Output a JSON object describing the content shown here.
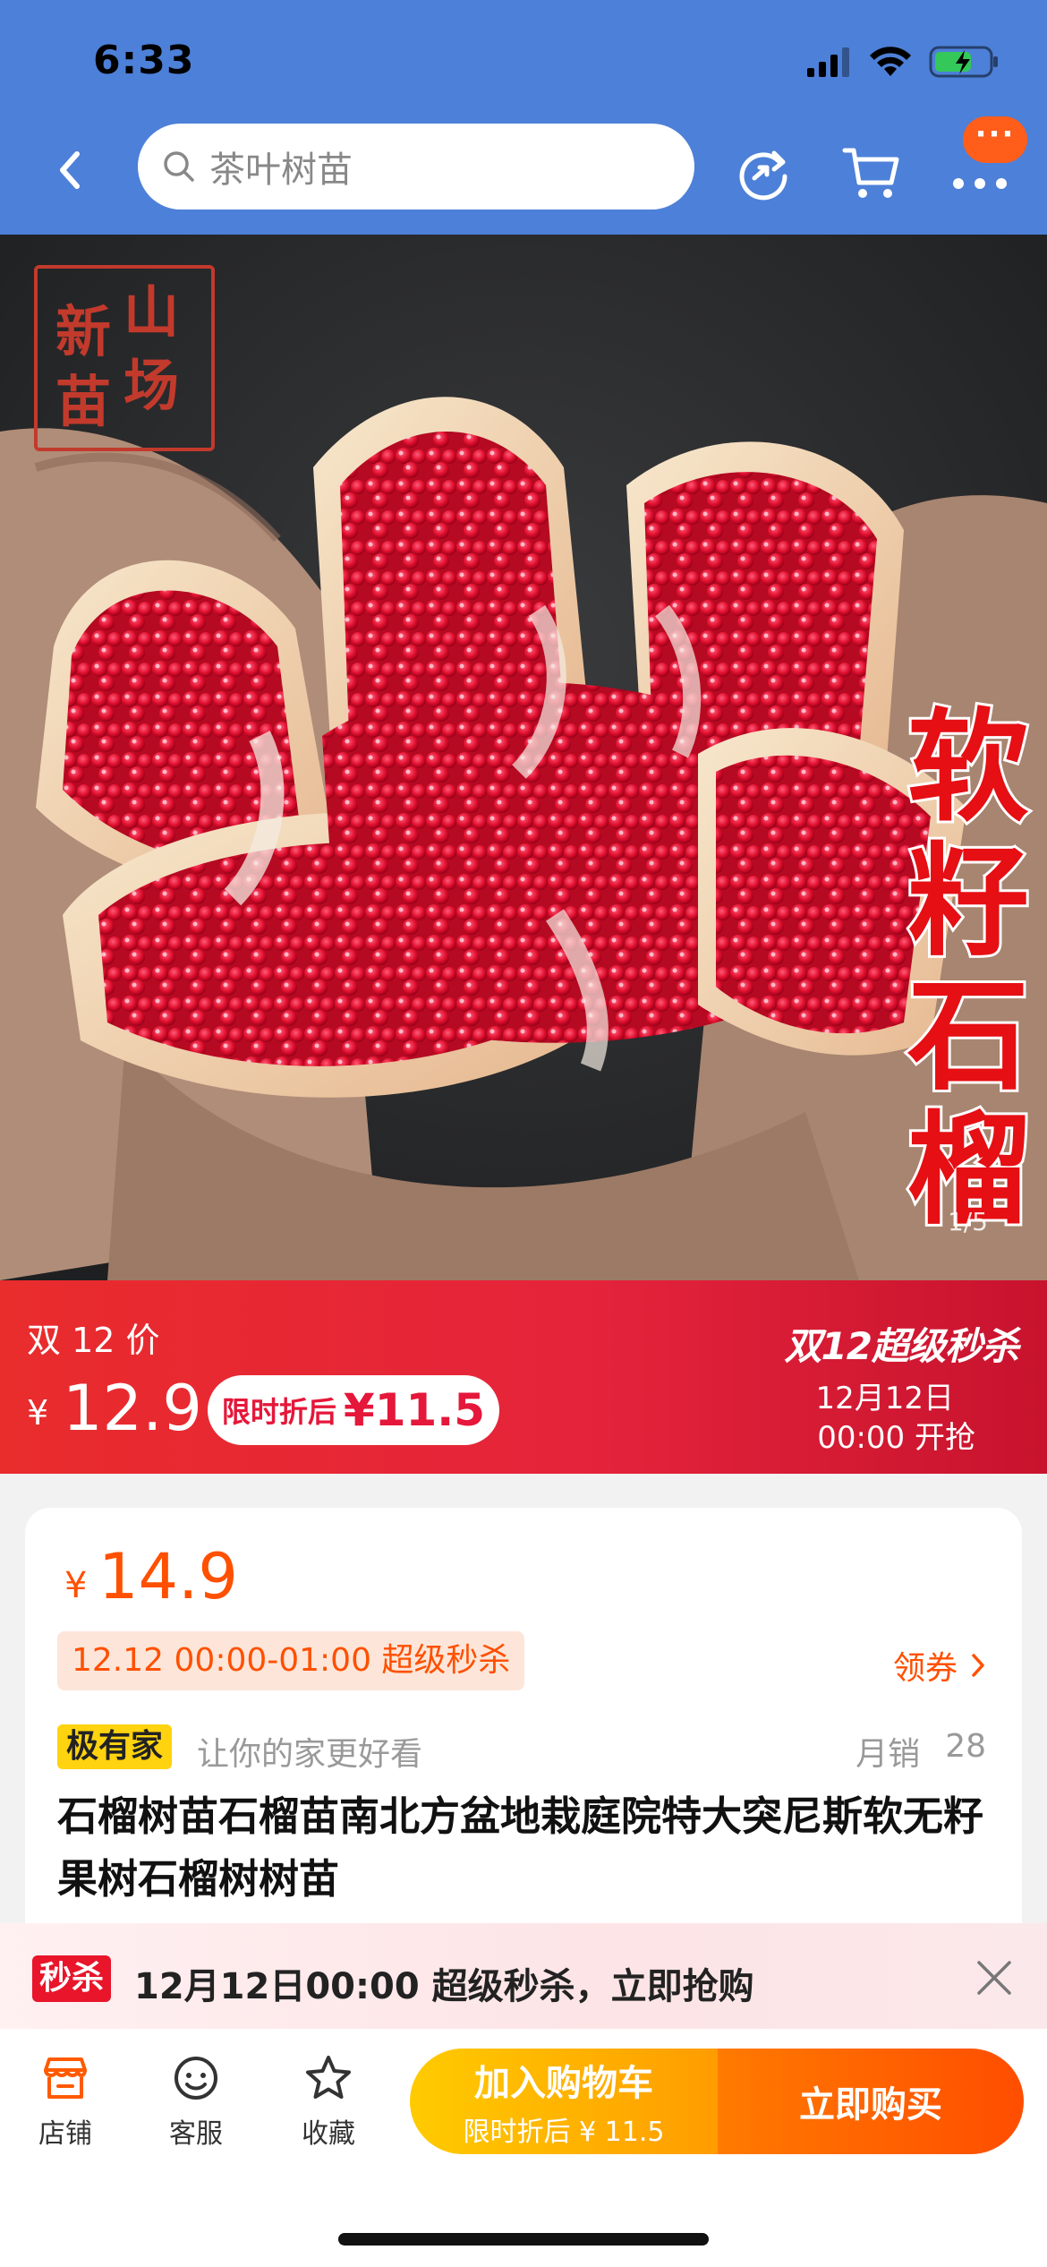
{
  "status_bar": {
    "time": "6:33"
  },
  "header": {
    "search_placeholder": "茶叶树苗",
    "more_badge": "···",
    "colors": {
      "bar": "#4d80d8",
      "accent": "#ff5d1a"
    }
  },
  "hero": {
    "seal_chars": [
      "新",
      "山",
      "苗",
      "场"
    ],
    "title_chars": [
      "软",
      "籽",
      "石",
      "榴"
    ],
    "pager": "1/5"
  },
  "promo": {
    "label": "双 12 价",
    "currency": "¥",
    "price": "12.9",
    "pill_label": "限时折后",
    "pill_price": "¥11.5",
    "event_title": "双12超级秒杀",
    "event_date": "12月12日",
    "event_time": "00:00 开抢"
  },
  "info": {
    "currency": "¥",
    "price": "14.9",
    "flash_tag": "12.12 00:00-01:00 超级秒杀",
    "coupon": "领券",
    "brand_badge": "极有家",
    "slogan": "让你的家更好看",
    "sales_label": "月销",
    "sales_count": "28",
    "title": "石榴树苗石榴苗南北方盆地栽庭院特大突尼斯软无籽果树石榴树树苗"
  },
  "notice": {
    "tag": "秒杀",
    "text": "12月12日00:00 超级秒杀，立即抢购"
  },
  "bottom_bar": {
    "tabs": [
      {
        "label": "店铺",
        "icon": "store-icon"
      },
      {
        "label": "客服",
        "icon": "customer-service-icon"
      },
      {
        "label": "收藏",
        "icon": "star-icon"
      }
    ],
    "cart_button": "加入购物车",
    "cart_sub": "限时折后 ¥ 11.5",
    "buy_button": "立即购买",
    "colors": {
      "cart": "#ffb400",
      "buy": "#ff5a00"
    }
  }
}
